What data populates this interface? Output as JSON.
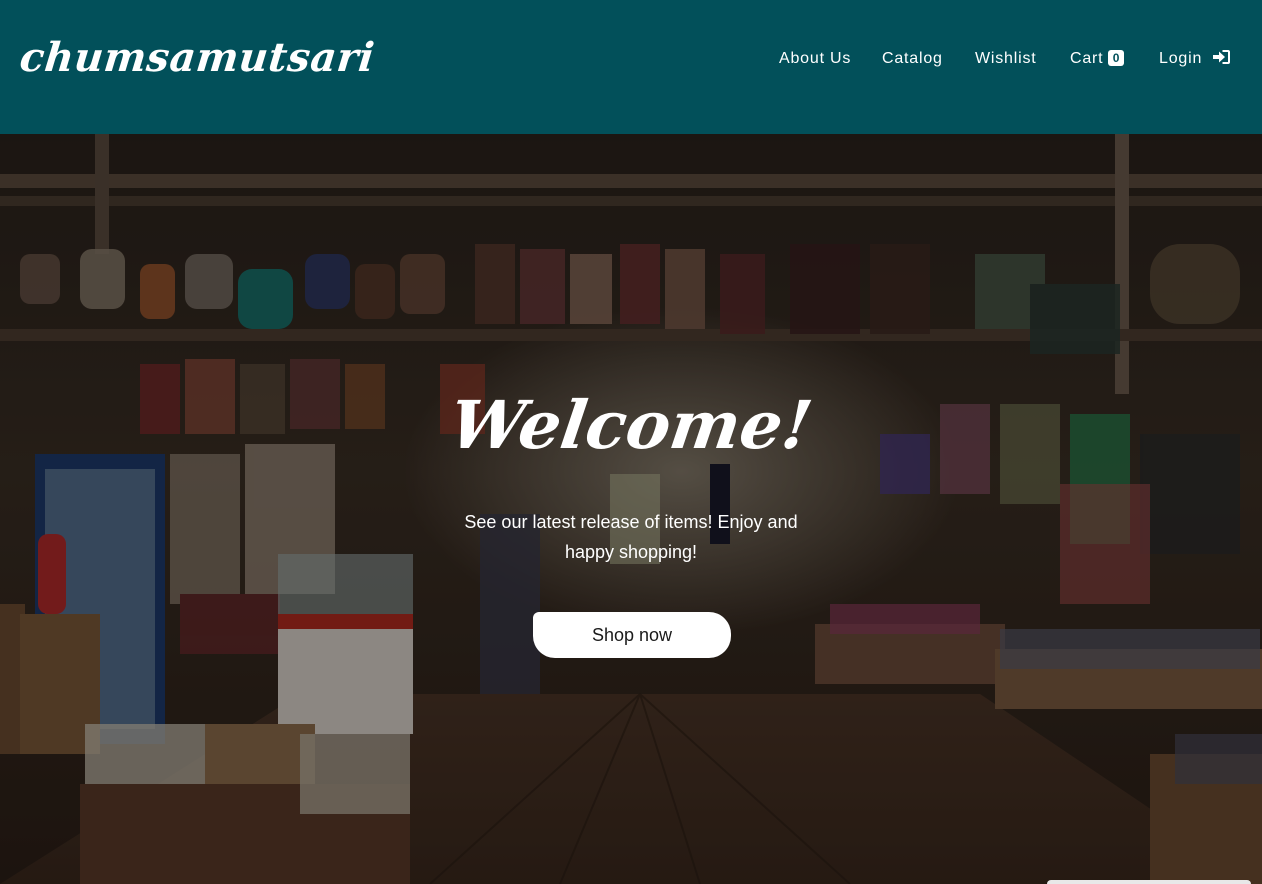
{
  "brand": {
    "name": "chumsamutsari"
  },
  "nav": {
    "about": "About Us",
    "catalog": "Catalog",
    "wishlist": "Wishlist",
    "cart": "Cart",
    "cart_count": "0",
    "login": "Login"
  },
  "hero": {
    "heading": "Welcome!",
    "subtitle": "See our latest release of items! Enjoy and happy shopping!",
    "cta": "Shop now"
  },
  "colors": {
    "navbar": "#02505a",
    "text": "#ffffff",
    "button": "#ffffff"
  },
  "icons": {
    "login": "sign-in-arrow-icon"
  }
}
